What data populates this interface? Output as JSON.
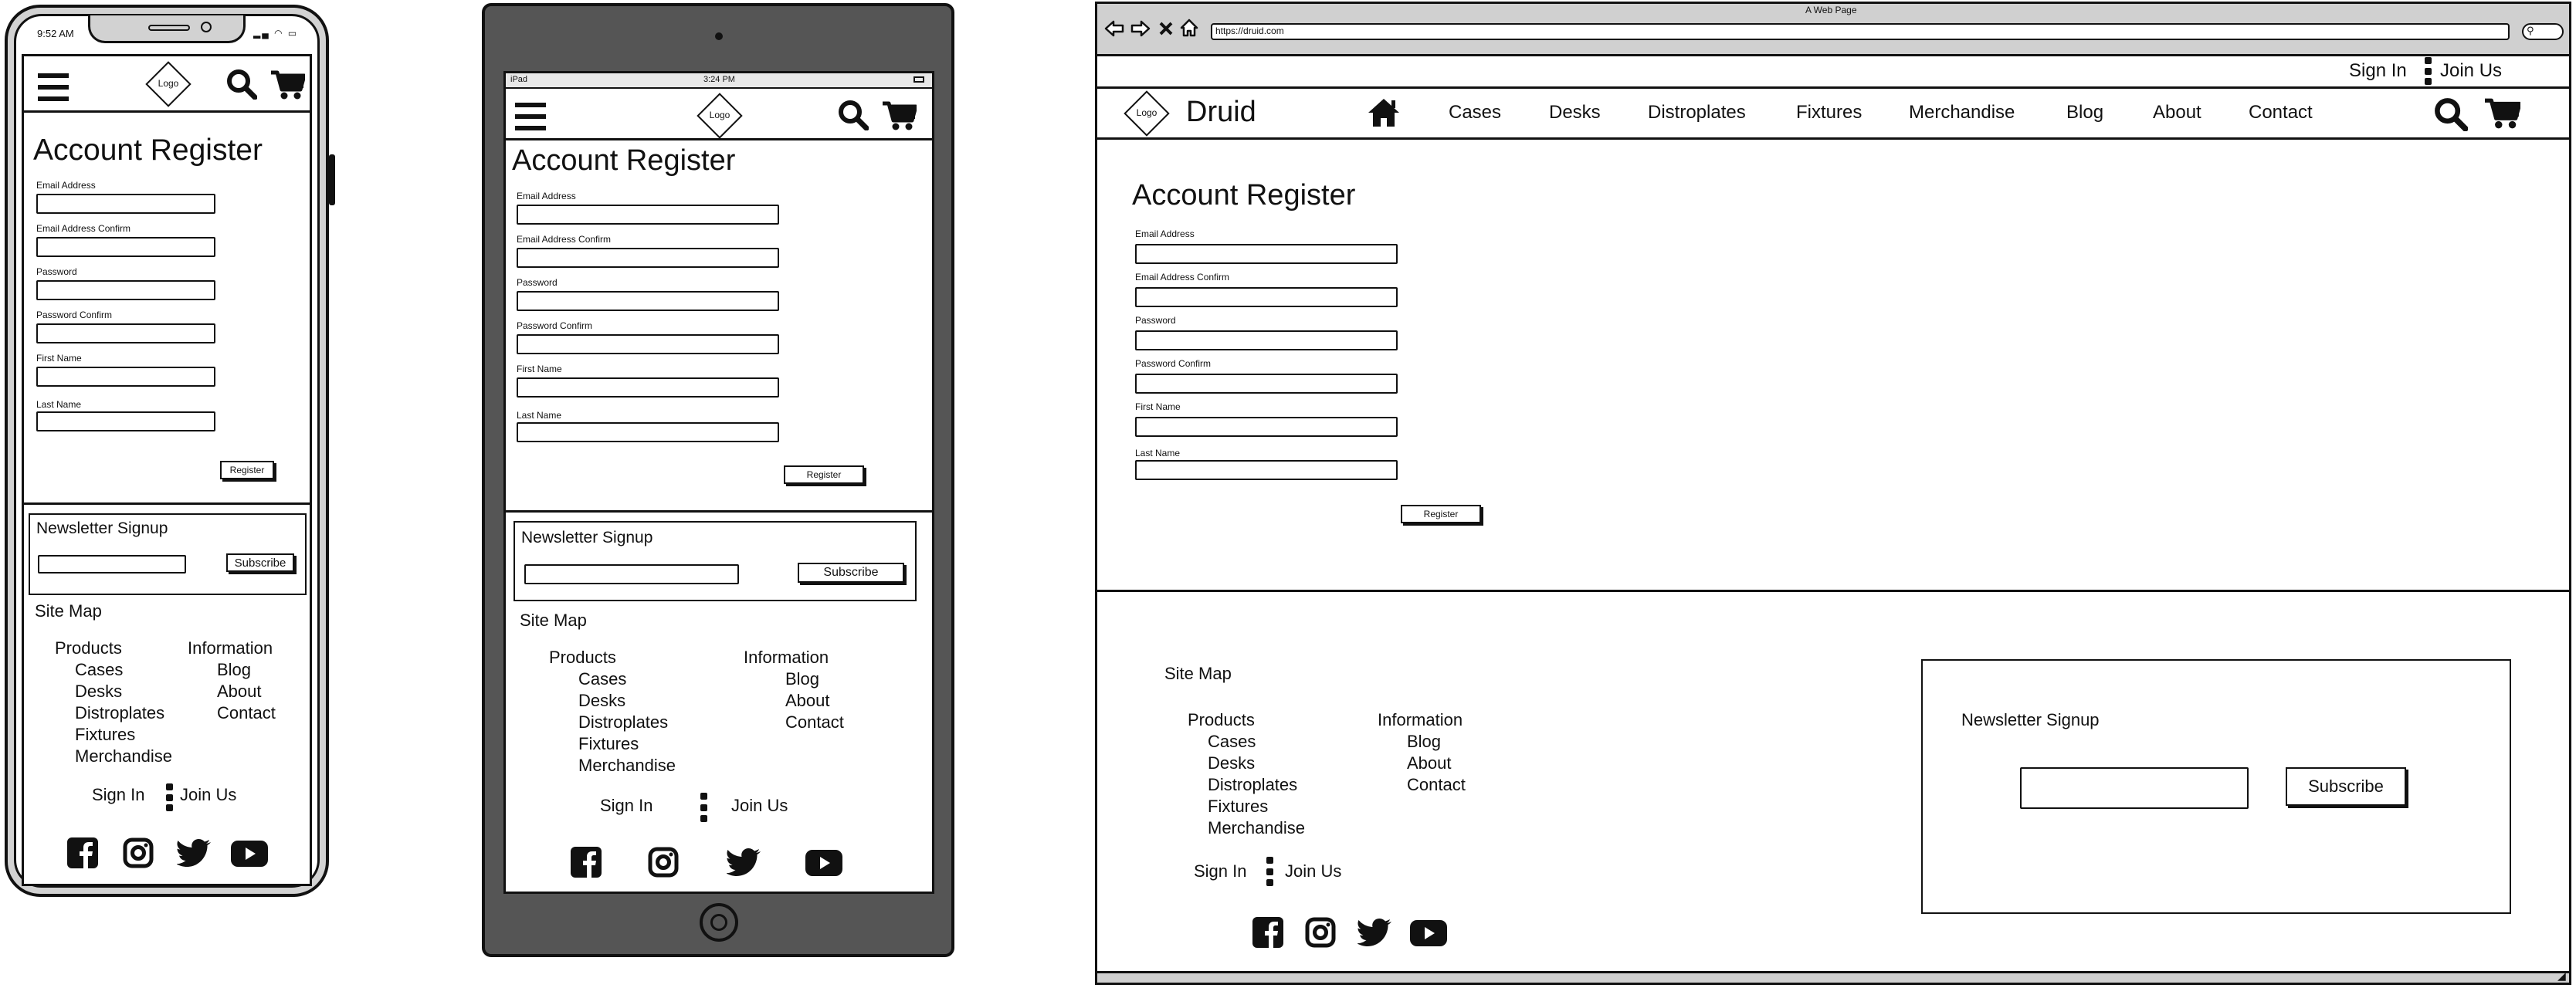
{
  "logo_text": "Logo",
  "brand": "Druid",
  "register": {
    "title": "Account Register",
    "fields": [
      "Email Address",
      "Email Address Confirm",
      "Password",
      "Password Confirm",
      "First Name",
      "Last Name"
    ],
    "button": "Register"
  },
  "newsletter": {
    "title": "Newsletter Signup",
    "button": "Subscribe"
  },
  "sitemap": {
    "title": "Site Map",
    "products_heading": "Products",
    "products": [
      "Cases",
      "Desks",
      "Distroplates",
      "Fixtures",
      "Merchandise"
    ],
    "info_heading": "Information",
    "info": [
      "Blog",
      "About",
      "Contact"
    ]
  },
  "auth": {
    "sign_in": "Sign In",
    "join_us": "Join Us"
  },
  "social_icons": [
    "facebook-icon",
    "instagram-icon",
    "twitter-icon",
    "youtube-icon"
  ],
  "phone": {
    "time": "9:52 AM"
  },
  "tablet": {
    "carrier": "iPad",
    "time": "3:24 PM"
  },
  "browser": {
    "window_title": "A Web Page",
    "url": "https://druid.com"
  },
  "desktop_nav": [
    "Cases",
    "Desks",
    "Distroplates",
    "Fixtures",
    "Merchandise",
    "Blog",
    "About",
    "Contact"
  ]
}
